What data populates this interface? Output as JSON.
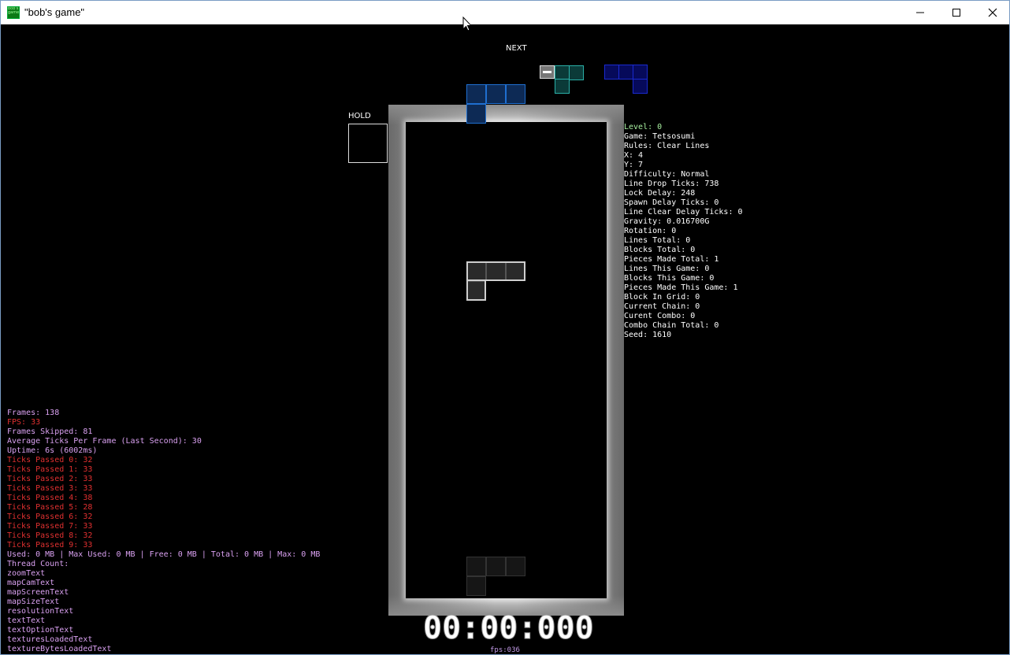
{
  "window": {
    "title": "\"bob's game\"",
    "icon": "bobs-game-icon"
  },
  "game": {
    "next_label": "NEXT",
    "hold_label": "HOLD",
    "timer": "00:00:000",
    "fps_small": "fps:036"
  },
  "stats": [
    {
      "text": "Level: 0",
      "color": "#a8f0a0"
    },
    {
      "text": "Game: Tetsosumi",
      "color": "#ffffff"
    },
    {
      "text": "Rules: Clear Lines",
      "color": "#ffffff"
    },
    {
      "text": "X: 4",
      "color": "#ffffff"
    },
    {
      "text": "Y: 7",
      "color": "#ffffff"
    },
    {
      "text": "Difficulty: Normal",
      "color": "#ffffff"
    },
    {
      "text": "Line Drop Ticks: 738",
      "color": "#ffffff"
    },
    {
      "text": "Lock Delay: 248",
      "color": "#ffffff"
    },
    {
      "text": "Spawn Delay Ticks: 0",
      "color": "#ffffff"
    },
    {
      "text": "Line Clear Delay Ticks: 0",
      "color": "#ffffff"
    },
    {
      "text": "Gravity: 0.016700G",
      "color": "#ffffff"
    },
    {
      "text": "Rotation: 0",
      "color": "#ffffff"
    },
    {
      "text": "Lines Total: 0",
      "color": "#ffffff"
    },
    {
      "text": "Blocks Total: 0",
      "color": "#ffffff"
    },
    {
      "text": "Pieces Made Total: 1",
      "color": "#ffffff"
    },
    {
      "text": "Lines This Game: 0",
      "color": "#ffffff"
    },
    {
      "text": "Blocks This Game: 0",
      "color": "#ffffff"
    },
    {
      "text": "Pieces Made This Game: 1",
      "color": "#ffffff"
    },
    {
      "text": "Block In Grid: 0",
      "color": "#ffffff"
    },
    {
      "text": "Current Chain: 0",
      "color": "#ffffff"
    },
    {
      "text": "Curent Combo: 0",
      "color": "#ffffff"
    },
    {
      "text": "Combo Chain Total: 0",
      "color": "#ffffff"
    },
    {
      "text": "Seed: 1610",
      "color": "#ffffff"
    }
  ],
  "debug": [
    {
      "text": "Frames: 138",
      "color": "#d9a0f0"
    },
    {
      "text": "FPS: 33",
      "color": "#e03030"
    },
    {
      "text": "Frames Skipped: 81",
      "color": "#d9a0f0"
    },
    {
      "text": "Average Ticks Per Frame (Last Second): 30",
      "color": "#d9a0f0"
    },
    {
      "text": "Uptime: 6s (6002ms)",
      "color": "#d9a0f0"
    },
    {
      "text": "Ticks Passed 0: 32",
      "color": "#e03030"
    },
    {
      "text": "Ticks Passed 1: 33",
      "color": "#e03030"
    },
    {
      "text": "Ticks Passed 2: 33",
      "color": "#e03030"
    },
    {
      "text": "Ticks Passed 3: 33",
      "color": "#e03030"
    },
    {
      "text": "Ticks Passed 4: 38",
      "color": "#e03030"
    },
    {
      "text": "Ticks Passed 5: 28",
      "color": "#e03030"
    },
    {
      "text": "Ticks Passed 6: 32",
      "color": "#e03030"
    },
    {
      "text": "Ticks Passed 7: 33",
      "color": "#e03030"
    },
    {
      "text": "Ticks Passed 8: 32",
      "color": "#e03030"
    },
    {
      "text": "Ticks Passed 9: 33",
      "color": "#e03030"
    },
    {
      "text": "Used: 0 MB | Max Used: 0 MB | Free: 0 MB | Total: 0 MB | Max: 0 MB",
      "color": "#d9a0f0"
    },
    {
      "text": "Thread Count:",
      "color": "#d9a0f0"
    },
    {
      "text": "zoomText",
      "color": "#d9a0f0"
    },
    {
      "text": "mapCamText",
      "color": "#d9a0f0"
    },
    {
      "text": "mapScreenText",
      "color": "#d9a0f0"
    },
    {
      "text": "mapSizeText",
      "color": "#d9a0f0"
    },
    {
      "text": "resolutionText",
      "color": "#d9a0f0"
    },
    {
      "text": "textText",
      "color": "#d9a0f0"
    },
    {
      "text": "textOptionText",
      "color": "#d9a0f0"
    },
    {
      "text": "texturesLoadedText",
      "color": "#d9a0f0"
    },
    {
      "text": "textureBytesLoadedText",
      "color": "#d9a0f0"
    }
  ]
}
